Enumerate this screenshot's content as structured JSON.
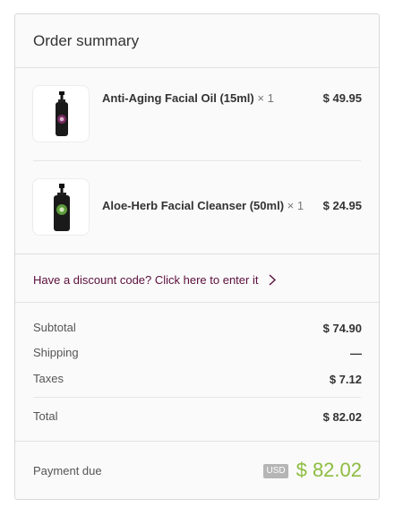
{
  "header": {
    "title": "Order summary"
  },
  "products": [
    {
      "name": "Anti-Aging Facial Oil (15ml)",
      "qty": "× 1",
      "price": "$ 49.95",
      "label_color": "#7a2c63"
    },
    {
      "name": "Aloe-Herb Facial Cleanser (50ml)",
      "qty": "× 1",
      "price": "$ 24.95",
      "label_color": "#5c9a3a"
    }
  ],
  "discount": {
    "text": "Have a discount code? Click here to enter it",
    "icon": "chevron-right-icon"
  },
  "totals": {
    "subtotal_label": "Subtotal",
    "subtotal_value": "$ 74.90",
    "shipping_label": "Shipping",
    "shipping_value": "—",
    "taxes_label": "Taxes",
    "taxes_value": "$ 7.12",
    "total_label": "Total",
    "total_value": "$ 82.02"
  },
  "payment": {
    "label": "Payment due",
    "currency": "USD",
    "amount": "$ 82.02",
    "amount_color": "#8cbc3f"
  }
}
